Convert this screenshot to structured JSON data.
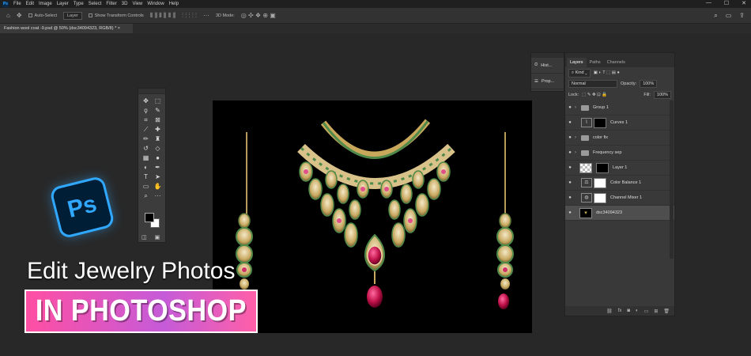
{
  "menubar": {
    "app_badge": "Ps",
    "items": [
      "File",
      "Edit",
      "Image",
      "Layer",
      "Type",
      "Select",
      "Filter",
      "3D",
      "View",
      "Window",
      "Help"
    ],
    "win_minimize": "—",
    "win_maximize": "☐",
    "win_close": "✕"
  },
  "options_bar": {
    "auto_select_label": "Auto-Select",
    "auto_select_value": "Layer",
    "show_transform_label": "Show Transform Controls",
    "mode_3d_label": "3D Mode:"
  },
  "document": {
    "tab_title": "Fashion wool coat -9.psd @ 50% (dsc34094323, RGB/8) *"
  },
  "mini_panel": {
    "history_label": "Hist...",
    "properties_label": "Prop..."
  },
  "layers_panel": {
    "tabs": [
      "Layers",
      "Paths",
      "Channels"
    ],
    "kind_label": "Kind",
    "blend_mode": "Normal",
    "opacity_label": "Opacity:",
    "opacity_value": "100%",
    "lock_label": "Lock:",
    "fill_label": "Fill:",
    "fill_value": "100%",
    "layers": [
      {
        "name": "Group 1"
      },
      {
        "name": "Curves 1"
      },
      {
        "name": "color fix"
      },
      {
        "name": "Frequency sep"
      },
      {
        "name": "Layer 1"
      },
      {
        "name": "Color Balance 1"
      },
      {
        "name": "Channel Mixer 1"
      },
      {
        "name": "dsc34094323"
      }
    ]
  },
  "overlay": {
    "logo_text": "Ps",
    "headline": "Edit Jewelry Photos",
    "banner": "IN PHOTOSHOP"
  },
  "colors": {
    "accent_blue": "#31a8ff",
    "banner_pink": "#ff4fa3",
    "banner_purple": "#c55bd8"
  }
}
